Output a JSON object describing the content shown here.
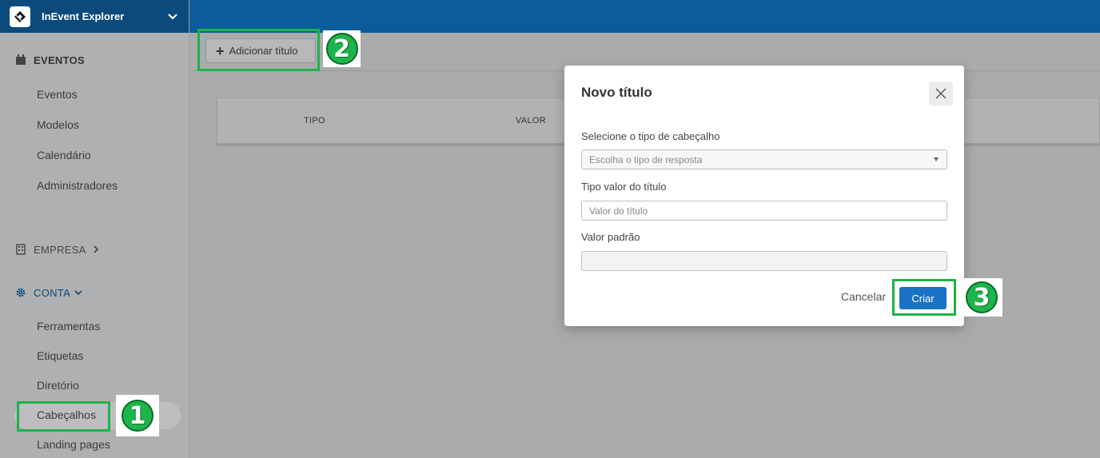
{
  "app": {
    "name": "InEvent Explorer"
  },
  "sidebar": {
    "sections": {
      "eventos": "EVENTOS",
      "empresa": "EMPRESA",
      "conta": "CONTA"
    },
    "eventos_items": [
      "Eventos",
      "Modelos",
      "Calendário",
      "Administradores"
    ],
    "conta_items": [
      "Ferramentas",
      "Etiquetas",
      "Diretório",
      "Cabeçalhos",
      "Landing pages"
    ]
  },
  "toolbar": {
    "add_label": "Adicionar título"
  },
  "table": {
    "columns": [
      "TIPO",
      "VALOR"
    ]
  },
  "modal": {
    "title": "Novo título",
    "fields": {
      "type_label": "Selecione o tipo de cabeçalho",
      "type_placeholder": "Escolha o tipo de resposta",
      "value_type_label": "Tipo valor do título",
      "value_type_placeholder": "Valor do título",
      "default_label": "Valor padrão",
      "default_value": ""
    },
    "cancel_label": "Cancelar",
    "create_label": "Criar"
  },
  "annotations": {
    "step1": "1",
    "step2": "2",
    "step3": "3"
  },
  "colors": {
    "accent_green": "#1fb24a",
    "primary_blue": "#1a72c6",
    "topbar": "#0b5c9a"
  }
}
